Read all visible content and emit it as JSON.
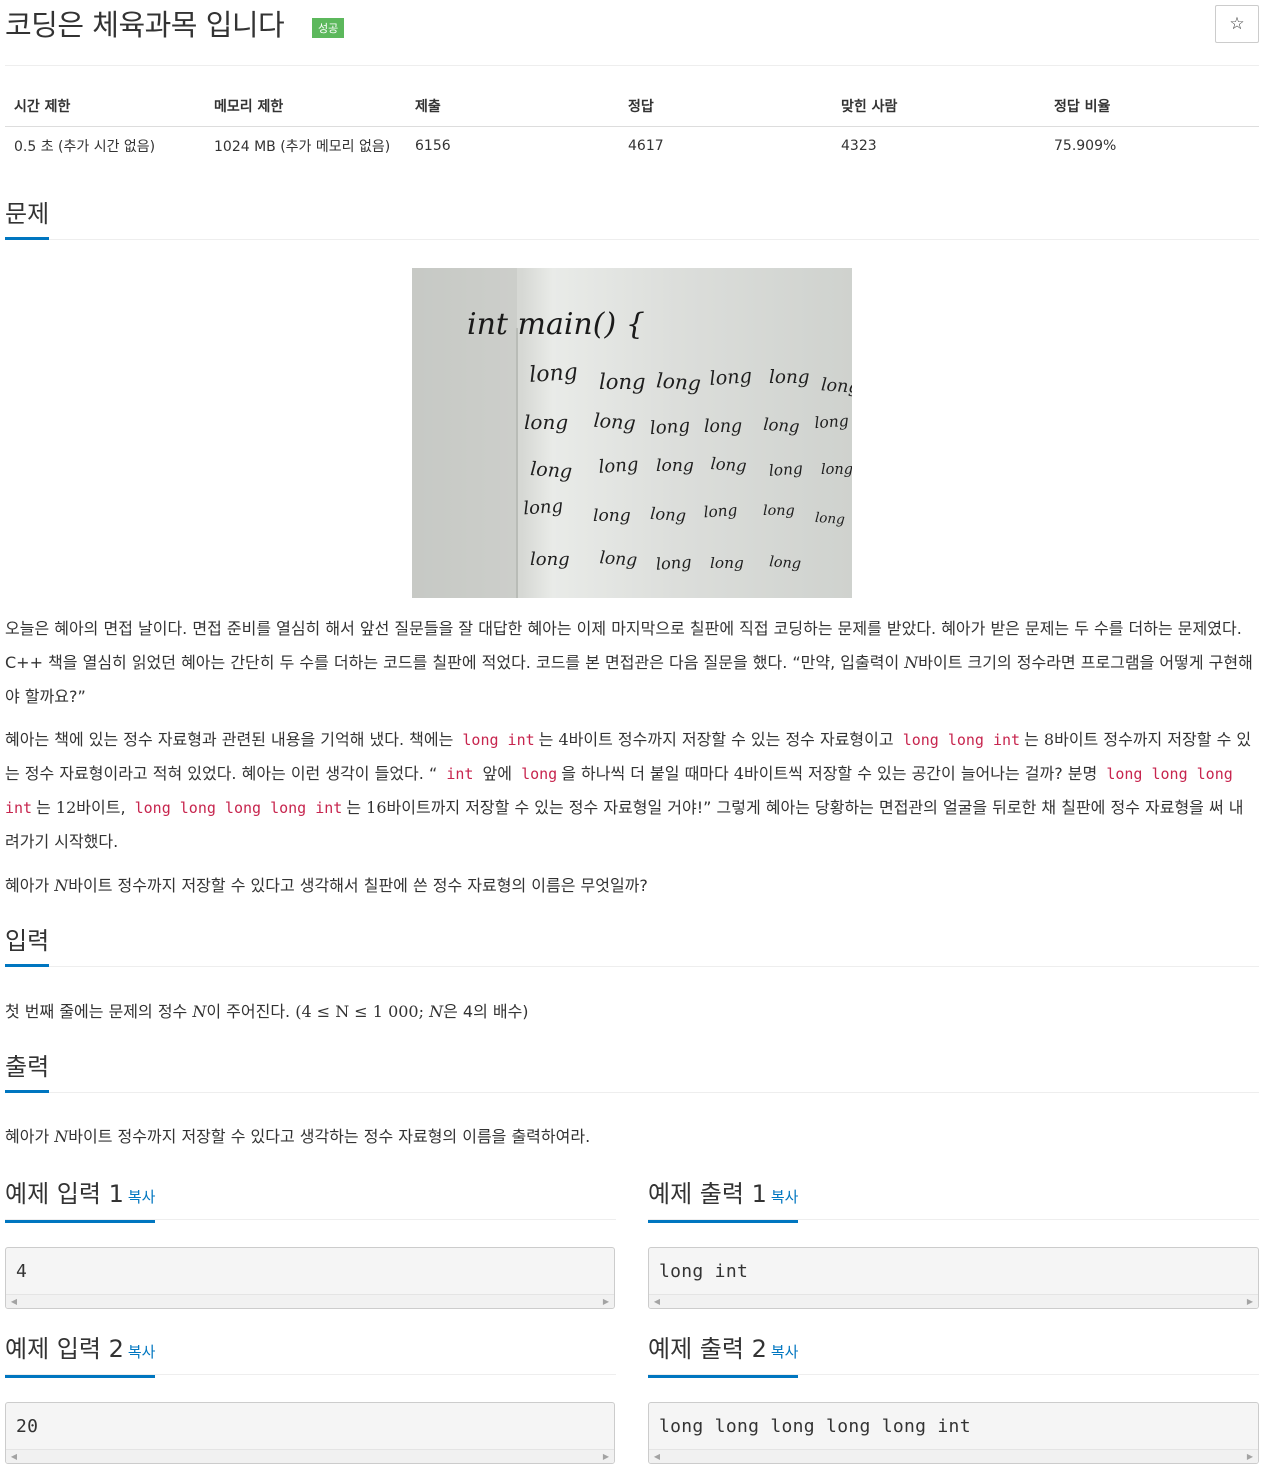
{
  "problem": {
    "title": "코딩은 체육과목 입니다",
    "result_badge": "성공",
    "star_icon": "☆"
  },
  "info_table": {
    "headers": [
      "시간 제한",
      "메모리 제한",
      "제출",
      "정답",
      "맞힌 사람",
      "정답 비율"
    ],
    "values": [
      "0.5 초 (추가 시간 없음)",
      "1024 MB (추가 메모리 없음)",
      "6156",
      "4617",
      "4323",
      "75.909%"
    ]
  },
  "sections": {
    "description": "문제",
    "input": "입력",
    "output": "출력"
  },
  "board_image": {
    "header_text": "int main() {",
    "word": "long"
  },
  "description": {
    "p1": {
      "a": "오늘은 혜아의 면접 날이다. 면접 준비를 열심히 해서 앞선 질문들을 잘 대답한 혜아는 이제 마지막으로 칠판에 직접 코딩하는 문제를 받았다. 혜아가 받은 문제는 두 수를 더하는 문제였다. C++ 책을 열심히 읽었던 혜아는 간단히 두 수를 더하는 코드를 칠판에 적었다. 코드를 본 면접관은 다음 질문을 했다. “만약, 입출력이 ",
      "var": "N",
      "b": "바이트 크기의 정수라면 프로그램을 어떻게 구현해야 할까요?”"
    },
    "p2": {
      "t1": "혜아는 책에 있는 정수 자료형과 관련된 내용을 기억해 냈다. 책에는",
      "c1": "long int",
      "t2": "는",
      "m1": "4",
      "t3": "바이트 정수까지 저장할 수 있는 정수 자료형이고",
      "c2": "long long int",
      "t4": "는",
      "m2": "8",
      "t5": "바이트 정수까지 저장할 수 있는 정수 자료형이라고 적혀 있었다. 혜아는 이런 생각이 들었다. “",
      "c3": "int",
      "t6": "앞에",
      "c4": "long",
      "t7": "을 하나씩 더 붙일 때마다",
      "m3": "4",
      "t8": "바이트씩 저장할 수 있는 공간이 늘어나는 걸까? 분명",
      "c5": "long long long int",
      "t9": "는",
      "m4": "12",
      "t10": "바이트,",
      "c6": "long long long long int",
      "t11": "는",
      "m5": "16",
      "t12": "바이트까지 저장할 수 있는 정수 자료형일 거야!” 그렇게 혜아는 당황하는 면접관의 얼굴을 뒤로한 채 칠판에 정수 자료형을 써 내려가기 시작했다."
    },
    "p3": {
      "a": "혜아가 ",
      "var": "N",
      "b": "바이트 정수까지 저장할 수 있다고 생각해서 칠판에 쓴 정수 자료형의 이름은 무엇일까?"
    }
  },
  "input": {
    "a": "첫 번째 줄에는 문제의 정수 ",
    "var": "N",
    "b": "이 주어진다. ",
    "math": "(4 ≤ N ≤ 1 000; ",
    "var2": "N",
    "c": "은 4의 배수)"
  },
  "output": {
    "a": "혜아가 ",
    "var": "N",
    "b": "바이트 정수까지 저장할 수 있다고 생각하는 정수 자료형의 이름을 출력하여라."
  },
  "samples": {
    "copy_label": "복사",
    "in1_title": "예제 입력 1",
    "out1_title": "예제 출력 1",
    "in2_title": "예제 입력 2",
    "out2_title": "예제 출력 2",
    "in1": "4",
    "out1": "long int",
    "in2": "20",
    "out2": "long long long long long int"
  },
  "colors": {
    "accent": "#0076c0",
    "success_badge": "#5cb85c",
    "code_red": "#c7254e"
  }
}
